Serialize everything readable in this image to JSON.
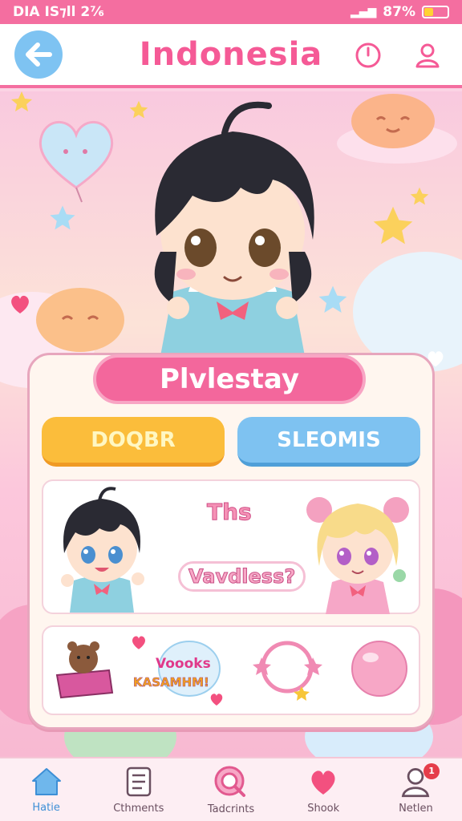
{
  "status_bar": {
    "left_text": "DIA IS⁊ll 2⁷⁄₆",
    "right_text": "87%",
    "battery_level": 0.4
  },
  "header": {
    "title": "Indonesia",
    "back_icon": "arrow-left-icon",
    "timer_icon": "clock-icon",
    "profile_icon": "user-icon"
  },
  "panel": {
    "title": "Plvlestay",
    "buttons": [
      {
        "label": "DOQBR",
        "color": "#fbbd3b"
      },
      {
        "label": "SLEOMIS",
        "color": "#7ec2f1"
      }
    ],
    "dialogue": {
      "line1": "Ths",
      "line2": "Vavdless?"
    },
    "items": {
      "sticker_text_top": "Voooks",
      "sticker_text_bottom": "KASAMHM!"
    }
  },
  "nav": {
    "items": [
      {
        "label": "Hatie",
        "icon": "home-icon",
        "active": true
      },
      {
        "label": "Cthments",
        "icon": "document-icon",
        "active": false
      },
      {
        "label": "Tadcrints",
        "icon": "magnifier-icon",
        "active": false
      },
      {
        "label": "Shook",
        "icon": "heart-icon",
        "active": false
      },
      {
        "label": "Netlen",
        "icon": "user-icon",
        "active": false,
        "badge": "1"
      }
    ]
  },
  "colors": {
    "accent_pink": "#f46ea0",
    "yellow": "#fbbd3b",
    "blue": "#7ec2f1"
  }
}
